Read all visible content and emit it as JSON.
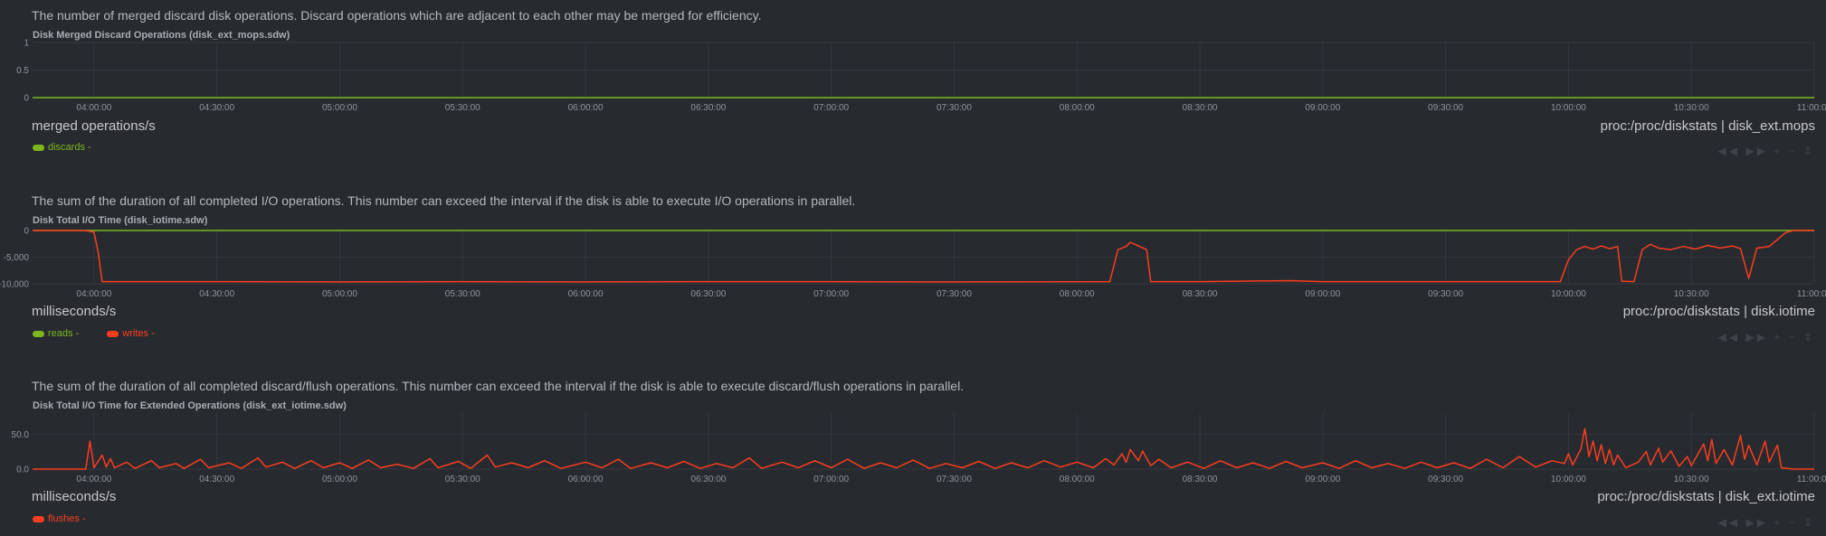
{
  "charts": [
    {
      "description": "The number of merged discard disk operations. Discard operations which are adjacent to each other may be merged for efficiency.",
      "title": "Disk Merged Discard Operations (disk_ext_mops.sdw)",
      "units": "merged operations/s",
      "source": "proc:/proc/diskstats | disk_ext.mops",
      "legend": [
        {
          "name": "discards",
          "value": "-",
          "color": "#7cb81d"
        }
      ]
    },
    {
      "description": "The sum of the duration of all completed I/O operations. This number can exceed the interval if the disk is able to execute I/O operations in parallel.",
      "title": "Disk Total I/O Time (disk_iotime.sdw)",
      "units": "milliseconds/s",
      "source": "proc:/proc/diskstats | disk.iotime",
      "legend": [
        {
          "name": "reads",
          "value": "-",
          "color": "#7cb81d"
        },
        {
          "name": "writes",
          "value": "-",
          "color": "#fc3c1e"
        }
      ]
    },
    {
      "description": "The sum of the duration of all completed discard/flush operations. This number can exceed the interval if the disk is able to execute discard/flush operations in parallel.",
      "title": "Disk Total I/O Time for Extended Operations (disk_ext_iotime.sdw)",
      "units": "milliseconds/s",
      "source": "proc:/proc/diskstats | disk_ext.iotime",
      "legend": [
        {
          "name": "flushes",
          "value": "-",
          "color": "#fc3c1e"
        }
      ]
    }
  ],
  "toolbar_glyphs": "◀◀ ▶▶ + − ⇕",
  "colors": {
    "green": "#7cb81d",
    "red": "#fc3c1e",
    "background": "#272b30",
    "grid": "#34383e"
  },
  "chart_data": [
    {
      "type": "line",
      "x_ticks": [
        "04:00:00",
        "04:30:00",
        "05:00:00",
        "05:30:00",
        "06:00:00",
        "06:30:00",
        "07:00:00",
        "07:30:00",
        "08:00:00",
        "08:30:00",
        "09:00:00",
        "09:30:00",
        "10:00:00",
        "10:30:00",
        "11:00:00"
      ],
      "xlim": [
        "03:45:00",
        "11:00:00"
      ],
      "y_ticks": [
        "1",
        "0.5",
        "0"
      ],
      "ylim": [
        0,
        1
      ],
      "series": [
        {
          "name": "discards",
          "color": "#7cb81d",
          "points": [
            [
              "03:45:00",
              0
            ],
            [
              "11:00:00",
              0
            ]
          ]
        }
      ]
    },
    {
      "type": "line",
      "x_ticks": [
        "04:00:00",
        "04:30:00",
        "05:00:00",
        "05:30:00",
        "06:00:00",
        "06:30:00",
        "07:00:00",
        "07:30:00",
        "08:00:00",
        "08:30:00",
        "09:00:00",
        "09:30:00",
        "10:00:00",
        "10:30:00",
        "11:00:00"
      ],
      "xlim": [
        "03:45:00",
        "11:00:00"
      ],
      "y_ticks": [
        "0",
        "-5,000",
        "-10,000"
      ],
      "ylim": [
        -10000,
        0
      ],
      "series": [
        {
          "name": "reads",
          "color": "#7cb81d",
          "points": [
            [
              "03:45:00",
              0
            ],
            [
              "11:00:00",
              0
            ]
          ]
        },
        {
          "name": "writes",
          "color": "#fc3c1e",
          "points": [
            [
              "03:45:00",
              0
            ],
            [
              "03:55:00",
              0
            ],
            [
              "03:58:00",
              -50
            ],
            [
              "04:00:00",
              -300
            ],
            [
              "04:01:00",
              -4000
            ],
            [
              "04:02:00",
              -9600
            ],
            [
              "04:30:00",
              -9600
            ],
            [
              "05:00:00",
              -9650
            ],
            [
              "05:30:00",
              -9600
            ],
            [
              "06:00:00",
              -9650
            ],
            [
              "06:30:00",
              -9600
            ],
            [
              "07:00:00",
              -9600
            ],
            [
              "07:30:00",
              -9650
            ],
            [
              "08:08:00",
              -9600
            ],
            [
              "08:10:00",
              -3600
            ],
            [
              "08:12:00",
              -3000
            ],
            [
              "08:13:00",
              -2200
            ],
            [
              "08:15:00",
              -2900
            ],
            [
              "08:17:00",
              -3600
            ],
            [
              "08:18:00",
              -9600
            ],
            [
              "08:30:00",
              -9600
            ],
            [
              "08:52:00",
              -9400
            ],
            [
              "09:00:00",
              -9600
            ],
            [
              "09:30:00",
              -9600
            ],
            [
              "09:58:00",
              -9600
            ],
            [
              "10:00:00",
              -5500
            ],
            [
              "10:02:00",
              -3600
            ],
            [
              "10:04:00",
              -3000
            ],
            [
              "10:06:00",
              -3500
            ],
            [
              "10:08:00",
              -2900
            ],
            [
              "10:10:00",
              -3400
            ],
            [
              "10:12:00",
              -3000
            ],
            [
              "10:13:00",
              -9500
            ],
            [
              "10:16:00",
              -9600
            ],
            [
              "10:18:00",
              -3600
            ],
            [
              "10:20:00",
              -2600
            ],
            [
              "10:22:00",
              -3300
            ],
            [
              "10:25:00",
              -3600
            ],
            [
              "10:28:00",
              -3000
            ],
            [
              "10:31:00",
              -3500
            ],
            [
              "10:34:00",
              -2800
            ],
            [
              "10:37:00",
              -3300
            ],
            [
              "10:40:00",
              -2900
            ],
            [
              "10:42:00",
              -3400
            ],
            [
              "10:44:00",
              -9000
            ],
            [
              "10:46:00",
              -3300
            ],
            [
              "10:49:00",
              -3000
            ],
            [
              "10:53:00",
              -400
            ],
            [
              "10:55:00",
              0
            ],
            [
              "11:00:00",
              0
            ]
          ]
        }
      ]
    },
    {
      "type": "line",
      "x_ticks": [
        "04:00:00",
        "04:30:00",
        "05:00:00",
        "05:30:00",
        "06:00:00",
        "06:30:00",
        "07:00:00",
        "07:30:00",
        "08:00:00",
        "08:30:00",
        "09:00:00",
        "09:30:00",
        "10:00:00",
        "10:30:00",
        "11:00:00"
      ],
      "xlim": [
        "03:45:00",
        "11:00:00"
      ],
      "y_ticks": [
        "50.0",
        "0.0"
      ],
      "ylim": [
        0,
        80
      ],
      "series": [
        {
          "name": "flushes",
          "color": "#fc3c1e",
          "points": [
            [
              "03:45:00",
              0
            ],
            [
              "03:58:00",
              0
            ],
            [
              "03:59:00",
              40
            ],
            [
              "04:00:00",
              2
            ],
            [
              "04:02:00",
              20
            ],
            [
              "04:03:00",
              3
            ],
            [
              "04:04:00",
              15
            ],
            [
              "04:05:00",
              2
            ],
            [
              "04:08:00",
              10
            ],
            [
              "04:10:00",
              1
            ],
            [
              "04:14:00",
              12
            ],
            [
              "04:16:00",
              2
            ],
            [
              "04:20:00",
              8
            ],
            [
              "04:22:00",
              1
            ],
            [
              "04:26:00",
              14
            ],
            [
              "04:28:00",
              2
            ],
            [
              "04:33:00",
              9
            ],
            [
              "04:36:00",
              1
            ],
            [
              "04:40:00",
              16
            ],
            [
              "04:42:00",
              3
            ],
            [
              "04:46:00",
              10
            ],
            [
              "04:49:00",
              1
            ],
            [
              "04:53:00",
              12
            ],
            [
              "04:56:00",
              2
            ],
            [
              "05:00:00",
              9
            ],
            [
              "05:03:00",
              1
            ],
            [
              "05:07:00",
              13
            ],
            [
              "05:10:00",
              2
            ],
            [
              "05:14:00",
              7
            ],
            [
              "05:18:00",
              1
            ],
            [
              "05:22:00",
              15
            ],
            [
              "05:24:00",
              2
            ],
            [
              "05:29:00",
              11
            ],
            [
              "05:32:00",
              1
            ],
            [
              "05:36:00",
              20
            ],
            [
              "05:38:00",
              3
            ],
            [
              "05:42:00",
              9
            ],
            [
              "05:46:00",
              2
            ],
            [
              "05:50:00",
              12
            ],
            [
              "05:54:00",
              1
            ],
            [
              "06:00:00",
              10
            ],
            [
              "06:04:00",
              2
            ],
            [
              "06:08:00",
              14
            ],
            [
              "06:11:00",
              1
            ],
            [
              "06:16:00",
              9
            ],
            [
              "06:20:00",
              2
            ],
            [
              "06:24:00",
              11
            ],
            [
              "06:28:00",
              1
            ],
            [
              "06:32:00",
              8
            ],
            [
              "06:36:00",
              2
            ],
            [
              "06:40:00",
              16
            ],
            [
              "06:43:00",
              1
            ],
            [
              "06:48:00",
              10
            ],
            [
              "06:52:00",
              2
            ],
            [
              "06:56:00",
              12
            ],
            [
              "07:00:00",
              2
            ],
            [
              "07:04:00",
              14
            ],
            [
              "07:08:00",
              1
            ],
            [
              "07:12:00",
              9
            ],
            [
              "07:16:00",
              2
            ],
            [
              "07:20:00",
              13
            ],
            [
              "07:24:00",
              1
            ],
            [
              "07:28:00",
              8
            ],
            [
              "07:32:00",
              2
            ],
            [
              "07:36:00",
              11
            ],
            [
              "07:40:00",
              1
            ],
            [
              "07:44:00",
              9
            ],
            [
              "07:48:00",
              2
            ],
            [
              "07:52:00",
              12
            ],
            [
              "07:56:00",
              3
            ],
            [
              "08:00:00",
              10
            ],
            [
              "08:04:00",
              2
            ],
            [
              "08:07:00",
              15
            ],
            [
              "08:09:00",
              6
            ],
            [
              "08:11:00",
              22
            ],
            [
              "08:12:00",
              10
            ],
            [
              "08:13:00",
              28
            ],
            [
              "08:15:00",
              12
            ],
            [
              "08:16:00",
              26
            ],
            [
              "08:18:00",
              5
            ],
            [
              "08:20:00",
              14
            ],
            [
              "08:23:00",
              2
            ],
            [
              "08:27:00",
              10
            ],
            [
              "08:31:00",
              1
            ],
            [
              "08:35:00",
              12
            ],
            [
              "08:39:00",
              2
            ],
            [
              "08:43:00",
              9
            ],
            [
              "08:47:00",
              1
            ],
            [
              "08:51:00",
              11
            ],
            [
              "08:55:00",
              2
            ],
            [
              "09:00:00",
              9
            ],
            [
              "09:04:00",
              1
            ],
            [
              "09:08:00",
              12
            ],
            [
              "09:12:00",
              2
            ],
            [
              "09:16:00",
              8
            ],
            [
              "09:20:00",
              1
            ],
            [
              "09:24:00",
              10
            ],
            [
              "09:28:00",
              2
            ],
            [
              "09:32:00",
              9
            ],
            [
              "09:36:00",
              1
            ],
            [
              "09:40:00",
              14
            ],
            [
              "09:44:00",
              2
            ],
            [
              "09:48:00",
              18
            ],
            [
              "09:52:00",
              3
            ],
            [
              "09:56:00",
              12
            ],
            [
              "09:59:00",
              8
            ],
            [
              "10:00:00",
              22
            ],
            [
              "10:01:00",
              6
            ],
            [
              "10:03:00",
              28
            ],
            [
              "10:04:00",
              58
            ],
            [
              "10:05:00",
              18
            ],
            [
              "10:06:00",
              40
            ],
            [
              "10:07:00",
              12
            ],
            [
              "10:08:00",
              35
            ],
            [
              "10:09:00",
              8
            ],
            [
              "10:10:00",
              28
            ],
            [
              "10:11:00",
              6
            ],
            [
              "10:12:00",
              20
            ],
            [
              "10:14:00",
              2
            ],
            [
              "10:17:00",
              10
            ],
            [
              "10:19:00",
              25
            ],
            [
              "10:20:00",
              6
            ],
            [
              "10:22:00",
              30
            ],
            [
              "10:23:00",
              10
            ],
            [
              "10:25:00",
              26
            ],
            [
              "10:27:00",
              4
            ],
            [
              "10:29:00",
              18
            ],
            [
              "10:30:00",
              5
            ],
            [
              "10:33:00",
              36
            ],
            [
              "10:34:00",
              12
            ],
            [
              "10:35:00",
              42
            ],
            [
              "10:36:00",
              8
            ],
            [
              "10:38:00",
              28
            ],
            [
              "10:40:00",
              6
            ],
            [
              "10:42:00",
              48
            ],
            [
              "10:43:00",
              14
            ],
            [
              "10:44:00",
              34
            ],
            [
              "10:46:00",
              6
            ],
            [
              "10:48:00",
              40
            ],
            [
              "10:49:00",
              10
            ],
            [
              "10:51:00",
              34
            ],
            [
              "10:52:00",
              2
            ],
            [
              "10:55:00",
              0
            ],
            [
              "11:00:00",
              0
            ]
          ]
        }
      ]
    }
  ]
}
